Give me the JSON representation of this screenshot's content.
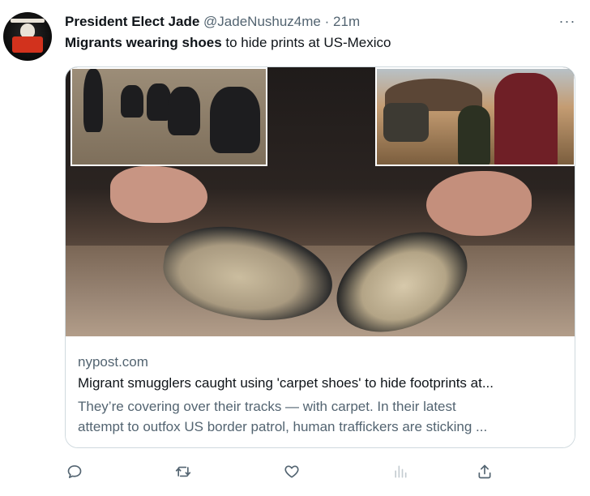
{
  "author": {
    "display_name": "President Elect Jade",
    "handle": "@JadeNushuz4me",
    "separator": "·",
    "time": "21m",
    "avatar_icon": "profile-avatar"
  },
  "tweet": {
    "text_bold": "Migrants wearing shoes",
    "text_rest": " to hide prints at US-Mexico"
  },
  "more_icon": "more-horizontal-icon",
  "more_glyph": "···",
  "card": {
    "domain": "nypost.com",
    "title": "Migrant smugglers caught using 'carpet shoes' to hide footprints at...",
    "description_line1": "They’re covering over their tracks — with carpet. In their latest",
    "description_line2": "attempt to outfox US border patrol, human traffickers are sticking ..."
  },
  "actions": [
    {
      "name": "reply",
      "icon": "reply-icon"
    },
    {
      "name": "retweet",
      "icon": "retweet-icon"
    },
    {
      "name": "like",
      "icon": "heart-icon"
    },
    {
      "name": "views",
      "icon": "analytics-icon"
    },
    {
      "name": "share",
      "icon": "share-icon"
    }
  ],
  "colors": {
    "text_primary": "#0f1419",
    "text_secondary": "#536471",
    "border": "#cfd9de"
  }
}
